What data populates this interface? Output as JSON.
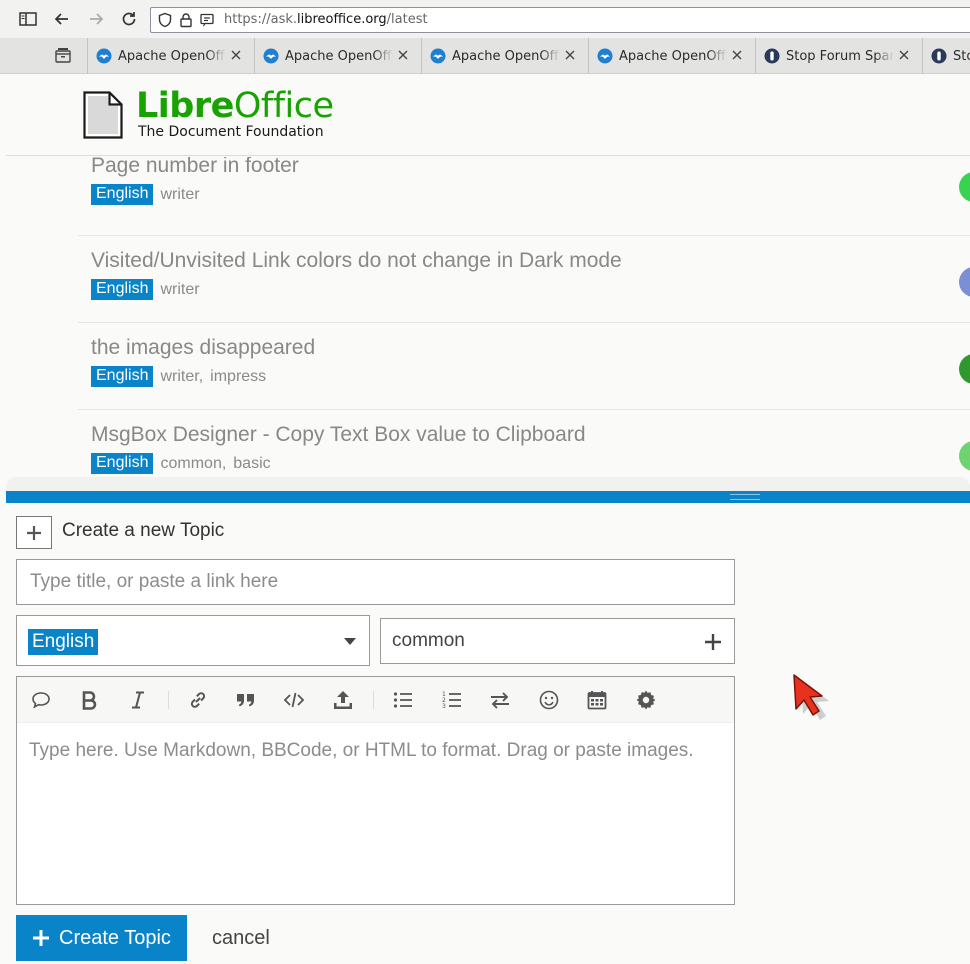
{
  "browser": {
    "url_scheme": "https://ask.",
    "url_host": "libreoffice.org",
    "url_path": "/latest",
    "tabs": [
      {
        "label": "Apache OpenOffice",
        "favicon": "openoffice-gull-icon"
      },
      {
        "label": "Apache OpenOffice",
        "favicon": "openoffice-gull-icon"
      },
      {
        "label": "Apache OpenOffice",
        "favicon": "openoffice-gull-icon"
      },
      {
        "label": "Apache OpenOffice",
        "favicon": "openoffice-gull-icon"
      },
      {
        "label": "Stop Forum Spam",
        "favicon": "stop-forum-spam-icon"
      },
      {
        "label": "Stop Forum Spam",
        "favicon": "stop-forum-spam-icon"
      }
    ]
  },
  "header": {
    "logo_word1": "Libre",
    "logo_word2": "Office",
    "logo_sub": "The Document Foundation",
    "brand_color": "#18a303"
  },
  "topics": [
    {
      "title": "Page number in footer",
      "category": "English",
      "tags": [
        "writer"
      ],
      "avatar_color": "#39d353"
    },
    {
      "title": "Visited/Unvisited Link colors do not change in Dark mode",
      "category": "English",
      "tags": [
        "writer"
      ],
      "avatar_color": "#7b8fd6"
    },
    {
      "title": "the images disappeared",
      "category": "English",
      "tags": [
        "writer,",
        "impress"
      ],
      "avatar_color": "#2e9a2e"
    },
    {
      "title": "MsgBox Designer - Copy Text Box value to Clipboard",
      "category": "English",
      "tags": [
        "common,",
        "basic"
      ],
      "avatar_color": "#6fd36f"
    }
  ],
  "composer": {
    "action_label": "Create a new Topic",
    "title_placeholder": "Type title, or paste a link here",
    "category_selected": "English",
    "tag_value": "common",
    "editor_placeholder": "Type here. Use Markdown, BBCode, or HTML to format. Drag or paste images.",
    "toolbar": [
      "quote-icon",
      "bold-icon",
      "italic-icon",
      "link-icon",
      "blockquote-icon",
      "code-icon",
      "upload-icon",
      "bullet-list-icon",
      "numbered-list-icon",
      "swap-icon",
      "emoji-icon",
      "calendar-icon",
      "gear-icon"
    ],
    "create_label": "Create Topic",
    "cancel_label": "cancel",
    "accent_color": "#0a84c9"
  }
}
